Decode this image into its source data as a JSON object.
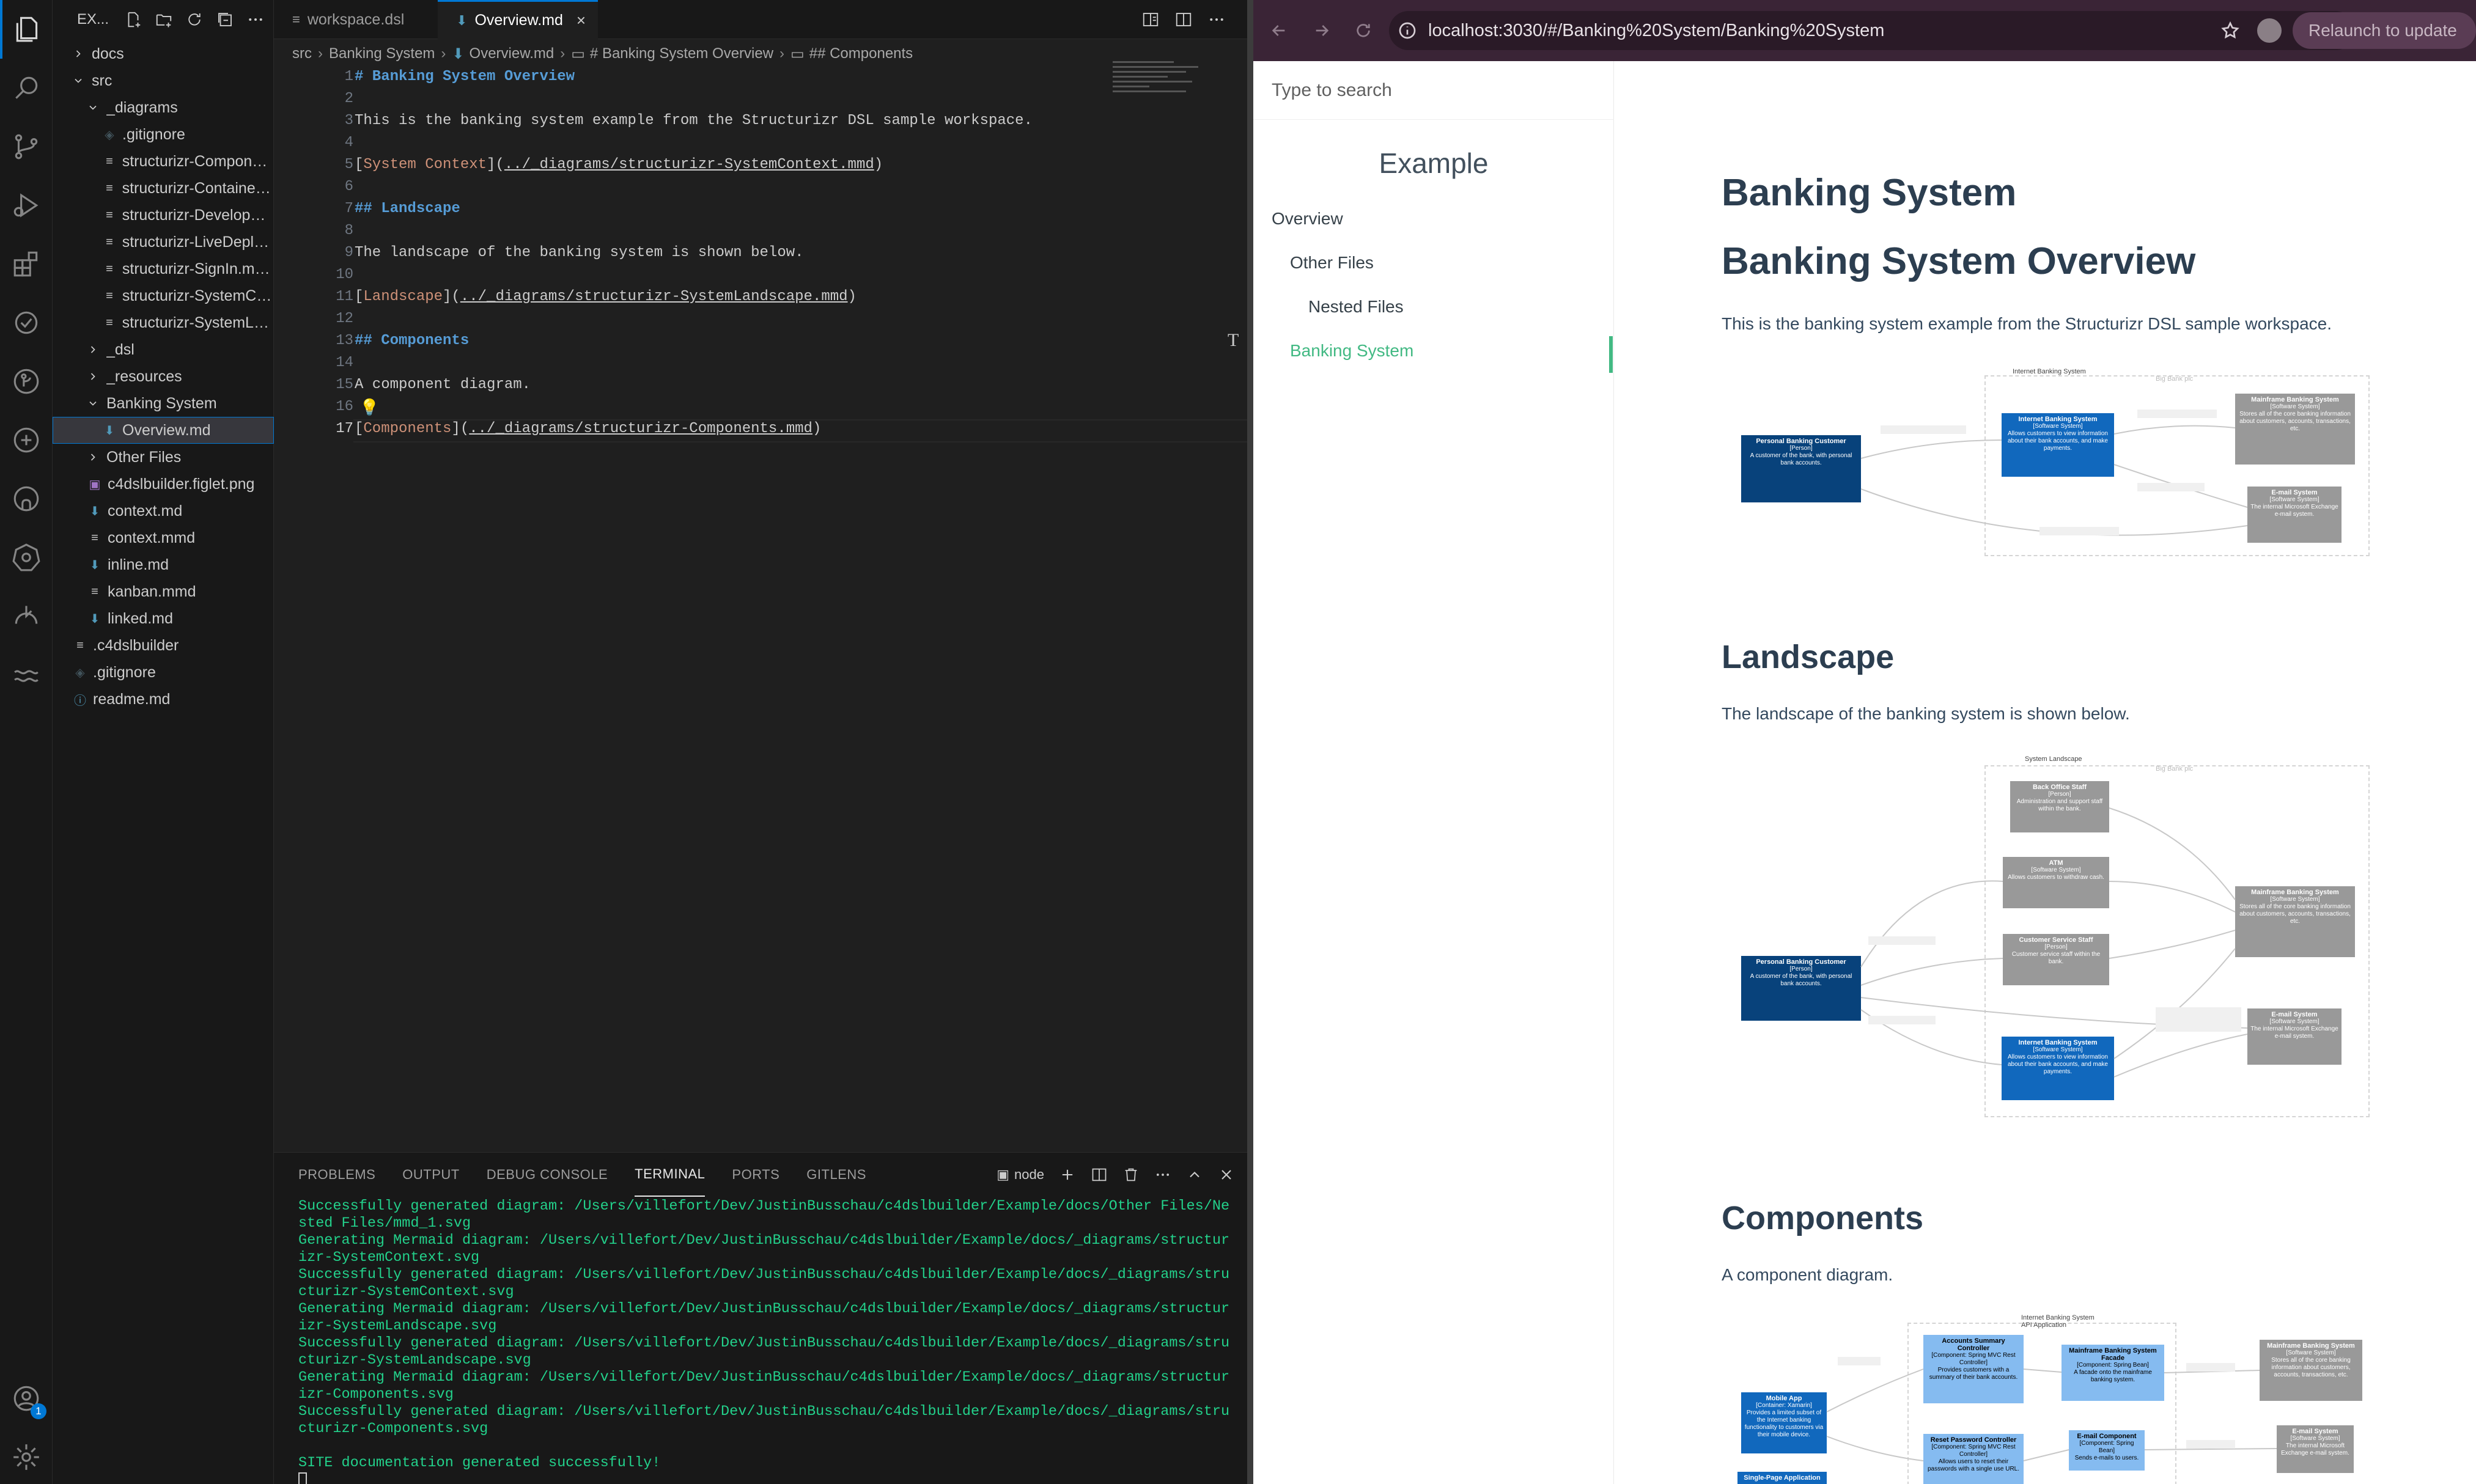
{
  "vscode": {
    "explorer": {
      "title": "EX...",
      "items": [
        {
          "label": "docs",
          "kind": "folder-closed",
          "depth": 0
        },
        {
          "label": "src",
          "kind": "folder-open",
          "depth": 0
        },
        {
          "label": "_diagrams",
          "kind": "folder-open",
          "depth": 1
        },
        {
          "label": ".gitignore",
          "kind": "gitignore",
          "depth": 2
        },
        {
          "label": "structurizr-Componen...",
          "kind": "mmd",
          "depth": 2
        },
        {
          "label": "structurizr-Containers....",
          "kind": "mmd",
          "depth": 2
        },
        {
          "label": "structurizr-Developme...",
          "kind": "mmd",
          "depth": 2
        },
        {
          "label": "structurizr-LiveDeploy...",
          "kind": "mmd",
          "depth": 2
        },
        {
          "label": "structurizr-SignIn.mmd",
          "kind": "mmd",
          "depth": 2
        },
        {
          "label": "structurizr-SystemCo...",
          "kind": "mmd",
          "depth": 2
        },
        {
          "label": "structurizr-SystemLan...",
          "kind": "mmd",
          "depth": 2
        },
        {
          "label": "_dsl",
          "kind": "folder-closed",
          "depth": 1
        },
        {
          "label": "_resources",
          "kind": "folder-closed",
          "depth": 1
        },
        {
          "label": "Banking System",
          "kind": "folder-open",
          "depth": 1
        },
        {
          "label": "Overview.md",
          "kind": "md",
          "depth": 2,
          "selected": true
        },
        {
          "label": "Other Files",
          "kind": "folder-closed",
          "depth": 1
        },
        {
          "label": "c4dslbuilder.figlet.png",
          "kind": "png",
          "depth": 1
        },
        {
          "label": "context.md",
          "kind": "md",
          "depth": 1
        },
        {
          "label": "context.mmd",
          "kind": "mmd",
          "depth": 1
        },
        {
          "label": "inline.md",
          "kind": "md",
          "depth": 1
        },
        {
          "label": "kanban.mmd",
          "kind": "mmd",
          "depth": 1
        },
        {
          "label": "linked.md",
          "kind": "md",
          "depth": 1
        },
        {
          "label": ".c4dslbuilder",
          "kind": "mmd",
          "depth": 0
        },
        {
          "label": ".gitignore",
          "kind": "gitignore",
          "depth": 0
        },
        {
          "label": "readme.md",
          "kind": "info",
          "depth": 0
        }
      ]
    },
    "tabs": [
      {
        "label": "workspace.dsl",
        "icon": "dsl-icon"
      },
      {
        "label": "Overview.md",
        "icon": "markdown-icon",
        "close": "×"
      }
    ],
    "breadcrumb": [
      "src",
      "Banking System",
      "Overview.md",
      "# Banking System Overview",
      "## Components"
    ],
    "code": {
      "line_numbers": [
        "1",
        "2",
        "3",
        "4",
        "5",
        "6",
        "7",
        "8",
        "9",
        "10",
        "11",
        "12",
        "13",
        "14",
        "15",
        "16",
        "17"
      ],
      "l1": "# Banking System Overview",
      "l3": "This is the banking system example from the Structurizr DSL sample workspace.",
      "l5_text": "System Context",
      "l5_url": "../_diagrams/structurizr-SystemContext.mmd",
      "l7": "## Landscape",
      "l9": "The landscape of the banking system is shown below.",
      "l11_text": "Landscape",
      "l11_url": "../_diagrams/structurizr-SystemLandscape.mmd",
      "l13": "## Components",
      "l15": "A component diagram.",
      "l17_text": "Components",
      "l17_url": "../_diagrams/structurizr-Components.mmd"
    },
    "panel": {
      "tabs": [
        "PROBLEMS",
        "OUTPUT",
        "DEBUG CONSOLE",
        "TERMINAL",
        "PORTS",
        "GITLENS"
      ],
      "active_tab": "TERMINAL",
      "shell": "node",
      "terminal_lines": [
        "Successfully generated diagram: /Users/villefort/Dev/JustinBusschau/c4dslbuilder/Example/docs/Other Files/Ne",
        "sted Files/mmd_1.svg",
        "Generating Mermaid diagram: /Users/villefort/Dev/JustinBusschau/c4dslbuilder/Example/docs/_diagrams/structur",
        "izr-SystemContext.svg",
        "Successfully generated diagram: /Users/villefort/Dev/JustinBusschau/c4dslbuilder/Example/docs/_diagrams/stru",
        "cturizr-SystemContext.svg",
        "Generating Mermaid diagram: /Users/villefort/Dev/JustinBusschau/c4dslbuilder/Example/docs/_diagrams/structur",
        "izr-SystemLandscape.svg",
        "Successfully generated diagram: /Users/villefort/Dev/JustinBusschau/c4dslbuilder/Example/docs/_diagrams/stru",
        "cturizr-SystemLandscape.svg",
        "Generating Mermaid diagram: /Users/villefort/Dev/JustinBusschau/c4dslbuilder/Example/docs/_diagrams/structur",
        "izr-Components.svg",
        "Successfully generated diagram: /Users/villefort/Dev/JustinBusschau/c4dslbuilder/Example/docs/_diagrams/stru",
        "cturizr-Components.svg",
        "",
        "SITE documentation generated successfully!"
      ]
    },
    "account_badge": "1"
  },
  "browser": {
    "url": "localhost:3030/#/Banking%20System/Banking%20System",
    "relaunch": "Relaunch to update",
    "search_placeholder": "Type to search",
    "app_name": "Example",
    "nav": [
      "Overview",
      "Other Files",
      "Nested Files",
      "Banking System"
    ],
    "active_nav": "Banking System",
    "content": {
      "h1": "Banking System",
      "h1b": "Banking System Overview",
      "intro": "This is the banking system example from the Structurizr DSL sample workspace.",
      "landscape_h": "Landscape",
      "landscape_p": "The landscape of the banking system is shown below.",
      "components_h": "Components",
      "components_p": "A component diagram."
    },
    "diagram1": {
      "frame_title": "Internet Banking System",
      "frame2_title": "Big Bank plc",
      "customer": {
        "name": "Personal Banking Customer",
        "type": "[Person]",
        "desc": "A customer of the bank, with personal bank accounts."
      },
      "ibs": {
        "name": "Internet Banking System",
        "type": "[Software System]",
        "desc": "Allows customers to view information about their bank accounts, and make payments."
      },
      "mainframe": {
        "name": "Mainframe Banking System",
        "type": "[Software System]",
        "desc": "Stores all of the core banking information about customers, accounts, transactions, etc."
      },
      "email": {
        "name": "E-mail System",
        "type": "[Software System]",
        "desc": "The internal Microsoft Exchange e-mail system."
      }
    },
    "diagram2": {
      "title": "System Landscape",
      "frame_title": "Big Bank plc",
      "backoffice": {
        "name": "Back Office Staff",
        "type": "[Person]",
        "desc": "Administration and support staff within the bank."
      },
      "atm": {
        "name": "ATM",
        "type": "[Software System]",
        "desc": "Allows customers to withdraw cash."
      },
      "css": {
        "name": "Customer Service Staff",
        "type": "[Person]",
        "desc": "Customer service staff within the bank."
      },
      "customer": {
        "name": "Personal Banking Customer",
        "type": "[Person]",
        "desc": "A customer of the bank, with personal bank accounts."
      },
      "mainframe": {
        "name": "Mainframe Banking System",
        "type": "[Software System]",
        "desc": "Stores all of the core banking information about customers, accounts, transactions, etc."
      },
      "email": {
        "name": "E-mail System",
        "type": "[Software System]",
        "desc": "The internal Microsoft Exchange e-mail system."
      },
      "ibs": {
        "name": "Internet Banking System",
        "type": "[Software System]",
        "desc": "Allows customers to view information about their bank accounts, and make payments."
      }
    },
    "diagram3": {
      "frame_title": "Internet Banking System",
      "frame_sub": "API Application",
      "mobile": {
        "name": "Mobile App",
        "type": "[Container: Xamarin]",
        "desc": "Provides a limited subset of the Internet banking functionality to customers via their mobile device."
      },
      "spa": {
        "name": "Single-Page Application"
      },
      "accounts": {
        "name": "Accounts Summary Controller",
        "type": "[Component: Spring MVC Rest Controller]",
        "desc": "Provides customers with a summary of their bank accounts."
      },
      "facade": {
        "name": "Mainframe Banking System Facade",
        "type": "[Component: Spring Bean]",
        "desc": "A facade onto the mainframe banking system."
      },
      "mainframe": {
        "name": "Mainframe Banking System",
        "type": "[Software System]",
        "desc": "Stores all of the core banking information about customers, accounts, transactions, etc."
      },
      "reset": {
        "name": "Reset Password Controller",
        "type": "[Component: Spring MVC Rest Controller]",
        "desc": "Allows users to reset their passwords with a single use URL."
      },
      "emailc": {
        "name": "E-mail Component",
        "type": "[Component: Spring Bean]",
        "desc": "Sends e-mails to users."
      },
      "email": {
        "name": "E-mail System",
        "type": "[Software System]",
        "desc": "The internal Microsoft Exchange e-mail system."
      }
    }
  }
}
